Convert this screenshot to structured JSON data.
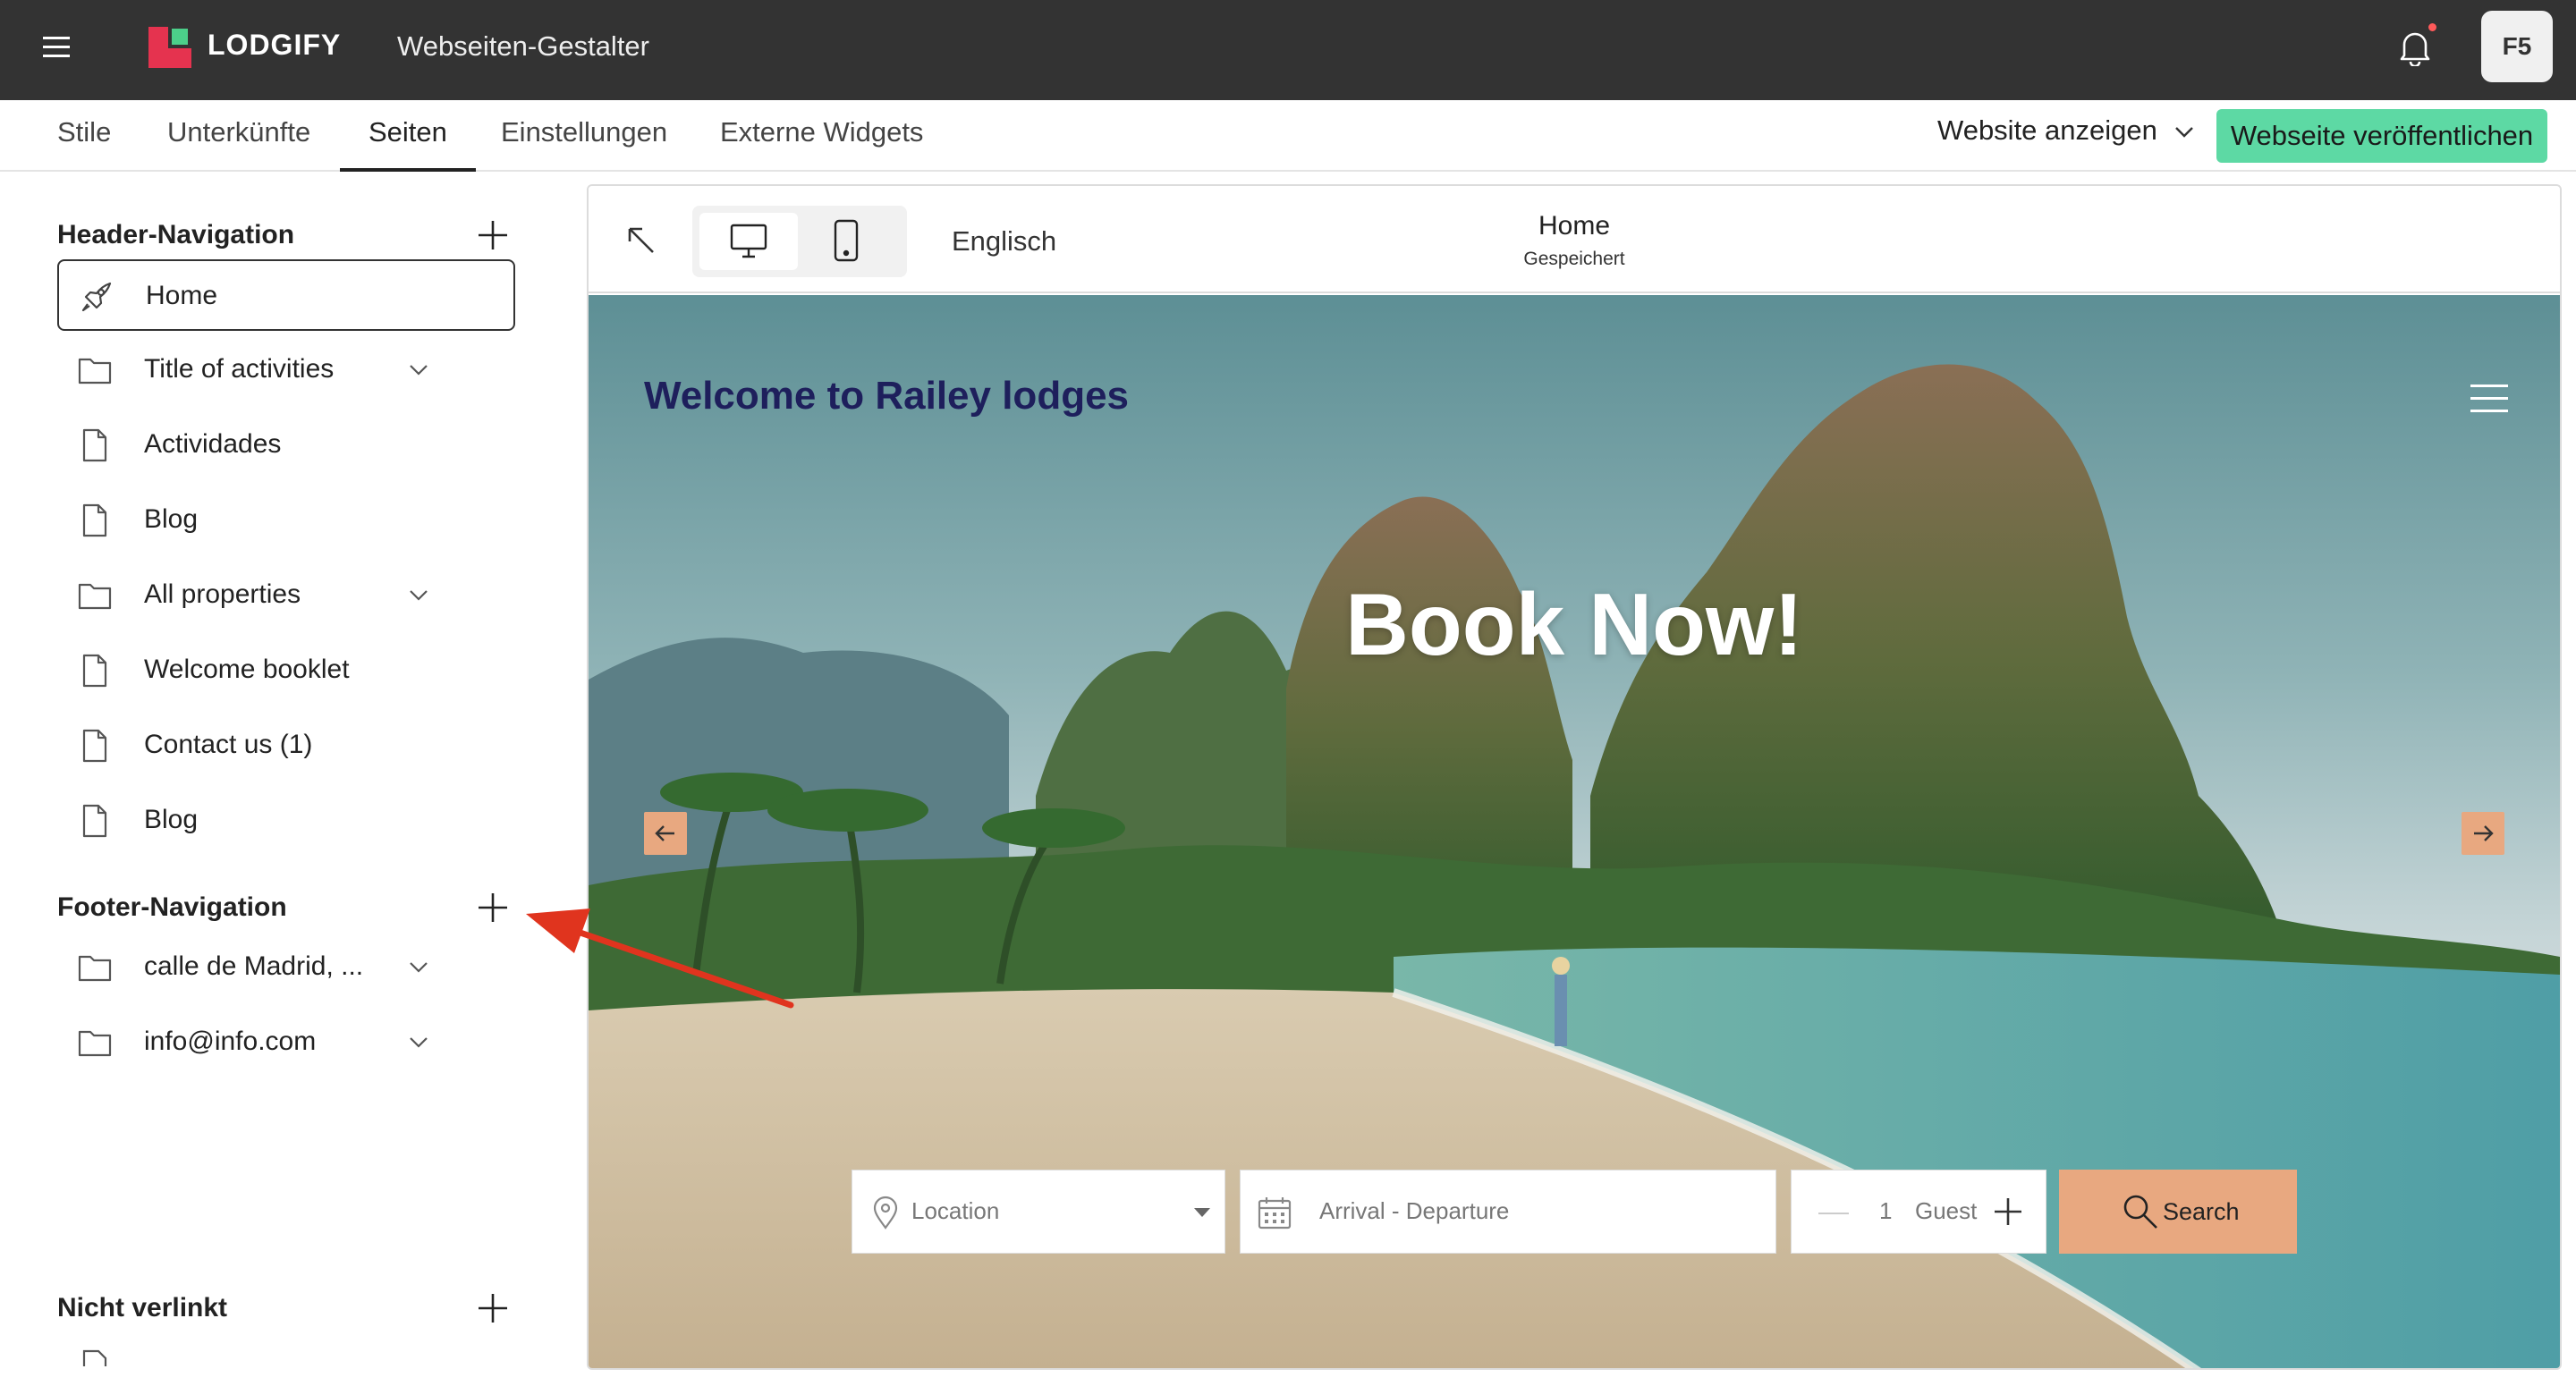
{
  "topbar": {
    "brand": "LODGIFY",
    "app_title": "Webseiten-Gestalter",
    "avatar_initials": "F5"
  },
  "tabs": [
    {
      "label": "Stile"
    },
    {
      "label": "Unterkünfte"
    },
    {
      "label": "Seiten"
    },
    {
      "label": "Einstellungen"
    },
    {
      "label": "Externe Widgets"
    }
  ],
  "active_tab": "Seiten",
  "header_actions": {
    "view_site": "Website anzeigen",
    "publish": "Webseite veröffentlichen"
  },
  "sidebar": {
    "header_nav": {
      "title": "Header-Navigation",
      "items": [
        {
          "label": "Home",
          "icon": "rocket-icon",
          "selected": true
        },
        {
          "label": "Title of activities",
          "icon": "folder-icon",
          "expandable": true
        },
        {
          "label": "Actividades",
          "icon": "page-icon"
        },
        {
          "label": "Blog",
          "icon": "page-icon"
        },
        {
          "label": "All properties",
          "icon": "folder-icon",
          "expandable": true
        },
        {
          "label": "Welcome booklet",
          "icon": "page-icon"
        },
        {
          "label": "Contact us (1)",
          "icon": "page-icon"
        },
        {
          "label": "Blog",
          "icon": "page-icon"
        }
      ]
    },
    "footer_nav": {
      "title": "Footer-Navigation",
      "items": [
        {
          "label": "calle de Madrid, ...",
          "icon": "folder-icon",
          "expandable": true
        },
        {
          "label": "info@info.com",
          "icon": "folder-icon",
          "expandable": true
        }
      ]
    },
    "unlinked": {
      "title": "Nicht verlinkt"
    }
  },
  "editor": {
    "language": "Englisch",
    "page_name": "Home",
    "page_status": "Gespeichert",
    "active_device": "desktop"
  },
  "preview": {
    "welcome": "Welcome to Railey lodges",
    "headline": "Book Now!",
    "search": {
      "location_placeholder": "Location",
      "dates_placeholder": "Arrival - Departure",
      "guest_count": "1",
      "guest_label": "Guest",
      "button": "Search"
    }
  },
  "colors": {
    "topbar_bg": "#333333",
    "publish_bg": "#5dd9a4",
    "brand_red": "#e5334f",
    "brand_green": "#4ccf8a",
    "accent_peach": "#e8a880",
    "welcome_text": "#1e1f5c",
    "annotation_arrow": "#e0341e"
  }
}
